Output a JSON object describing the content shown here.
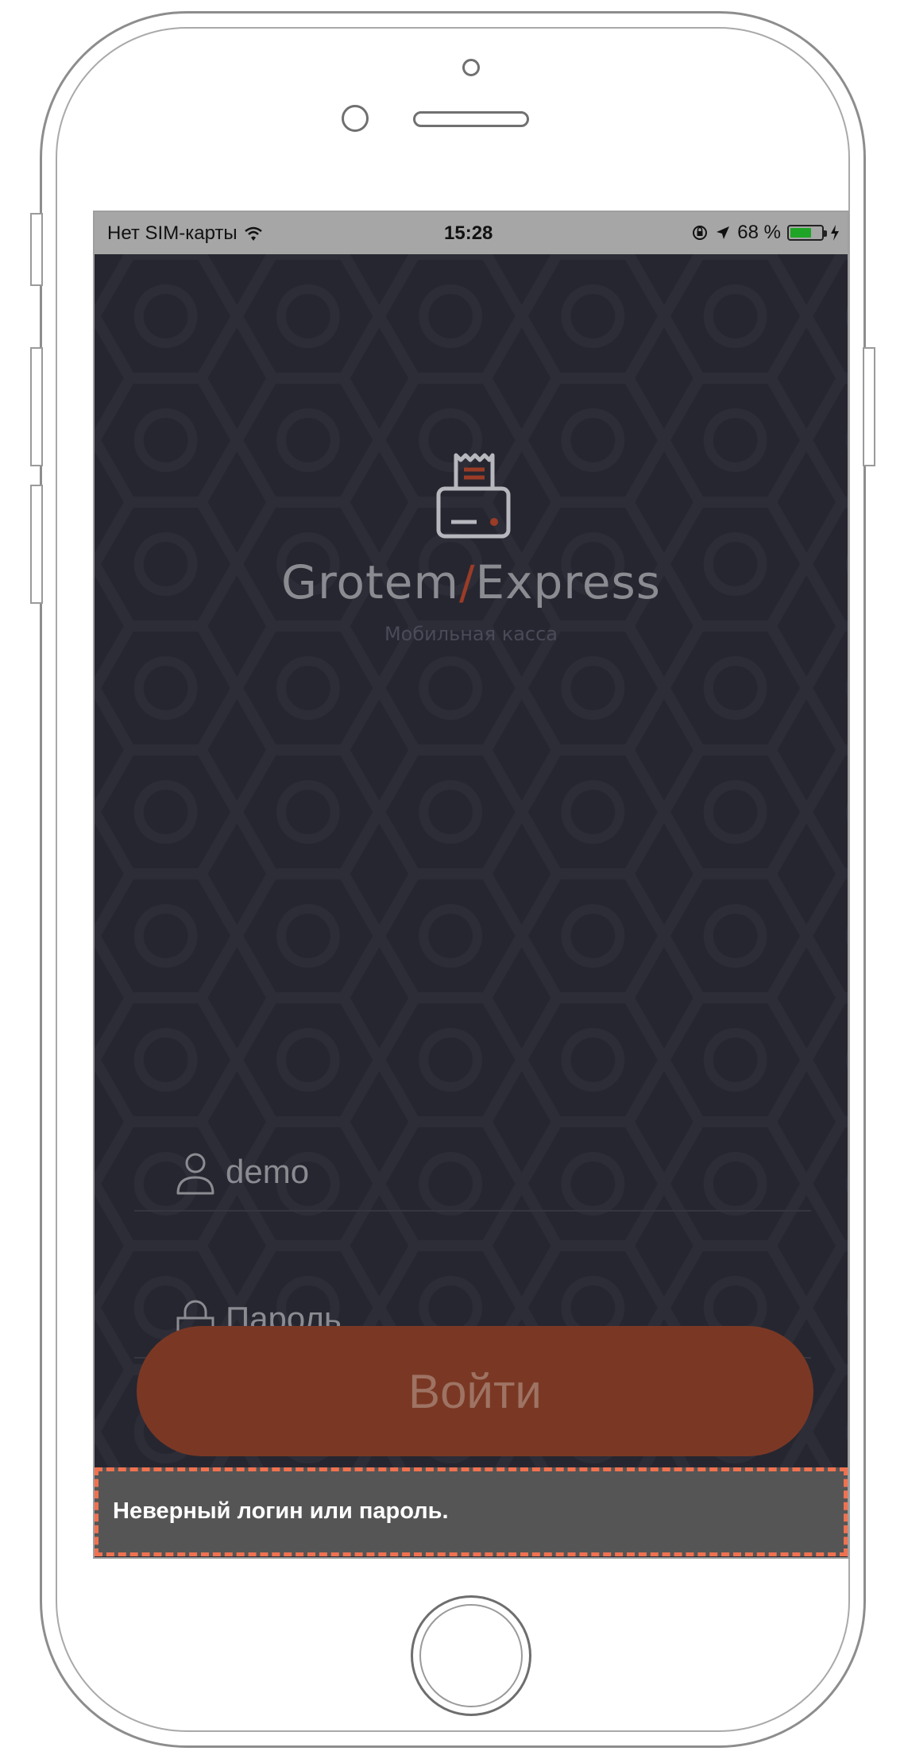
{
  "status_bar": {
    "carrier": "Нет SIM-карты",
    "time": "15:28",
    "battery_percent": "68 %",
    "battery_level": 0.68
  },
  "app": {
    "brand_part1": "Grotem",
    "brand_slash": "/",
    "brand_part2": "Express",
    "tagline": "Мобильная касса"
  },
  "login_form": {
    "username_value": "demo",
    "password_placeholder": "Пароль",
    "submit_label": "Войти"
  },
  "toast": {
    "message": "Неверный логин или пароль."
  },
  "colors": {
    "background": "#262630",
    "accent": "#7a3824",
    "brand_slash": "#9b3c26",
    "highlight_border": "#f0714f"
  }
}
